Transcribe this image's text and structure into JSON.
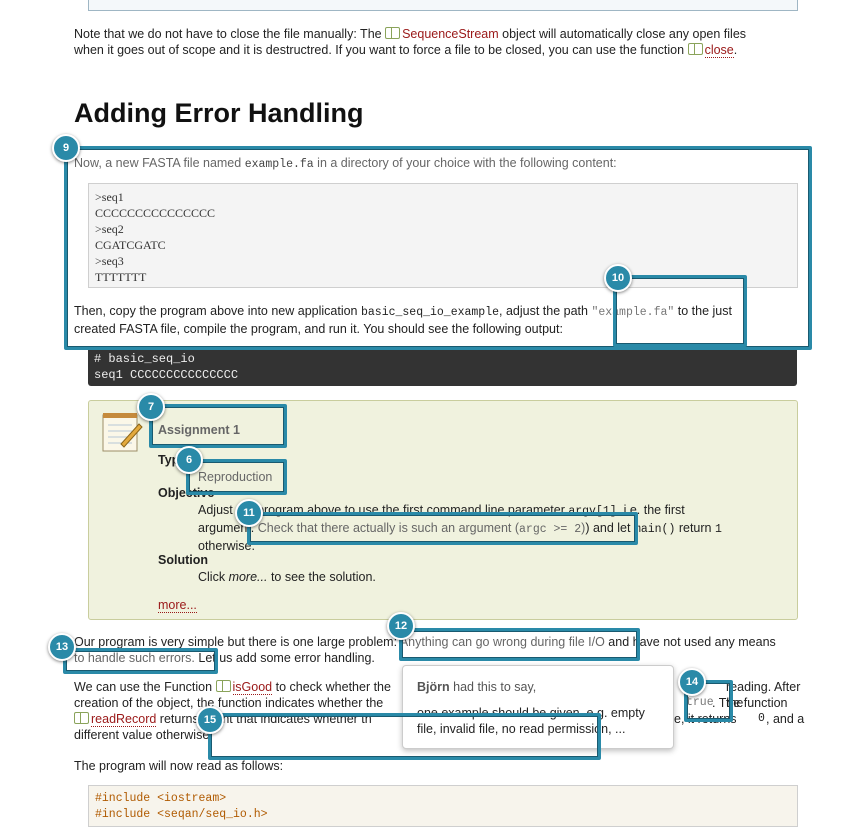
{
  "intro": {
    "p1_a": "Note that we do not have to close the file manually: The ",
    "p1_link": "SequenceStream",
    "p1_b": " object will automatically close any open files",
    "p2_a": "when it goes out of scope and it is destructred. If you want to force a file to be closed, you can use the function ",
    "p2_link": "close",
    "p2_b": "."
  },
  "section_title": "Adding Error Handling",
  "para_fasta": {
    "a": "Now, a new FASTA file named ",
    "code": "example.fa",
    "b": " in a directory of your choice with the following content:"
  },
  "fasta_lines": [
    ">seq1",
    "CCCCCCCCCCCCCCC",
    ">seq2",
    "CGATCGATC",
    ">seq3",
    "TTTTTTT"
  ],
  "para_copy": {
    "a": "Then, copy the program above into new application ",
    "code1": "basic_seq_io_example",
    "b": ", adjust the path ",
    "code2": "\"example.fa\"",
    "c": " to the just",
    "d": "created FASTA file, compile the program, and run it. You should see the following output:"
  },
  "output_lines": [
    "# basic_seq_io",
    "seq1    CCCCCCCCCCCCCCC"
  ],
  "assignment": {
    "title": "Assignment 1",
    "type_label": "Type",
    "type_value": "Reproduction",
    "objective_label": "Objective",
    "objective_1a": "Adjust the program above to use the first command line parameter ",
    "objective_1code": "argv[1]",
    "objective_1b": ", i.e. the first",
    "objective_2a": "argument. ",
    "objective_2b": "Check that there actually is such an argument (",
    "objective_2code": "argc >= 2",
    "objective_2c": ") and let ",
    "objective_2code2": "main()",
    "objective_2d": " return ",
    "objective_2code3": "1",
    "objective_3": "otherwise.",
    "solution_label": "Solution",
    "solution_a": "Click ",
    "solution_em": "more...",
    "solution_b": " to see the solution.",
    "more": "more..."
  },
  "para_simple": {
    "a": "Our program is very simple but there is one large problem: ",
    "b": "Anything can go wrong during file I/O",
    "c": " and have not used any means",
    "d": "to handle such errors.",
    "e": " Let us add some error handling."
  },
  "para_isgood": {
    "a": "We can use the Function ",
    "link1": "isGood",
    "b": " to check whether the",
    "c": "reading. After the",
    "d": "creation of the object, the function indicates whether the",
    "e": "true",
    "f": ". The function",
    "link2": "readRecord",
    "g": " returns an int that indicates whether th",
    "h": "e, it returns ",
    "code0": "0",
    "i": ", and a",
    "j": "different value otherwise."
  },
  "para_program": "The program will now read as follows:",
  "bottom_code": [
    "#include <iostream>",
    "#include <seqan/seq_io.h>"
  ],
  "comment": {
    "author": "Björn",
    "suffix": " had this to say,",
    "body": "one example should be given. e.g. empty file, invalid file, no read permission, ..."
  },
  "badges": [
    "9",
    "10",
    "7",
    "6",
    "11",
    "12",
    "13",
    "14",
    "15"
  ],
  "colors": {
    "highlight": "#2a8aa8",
    "link": "#9a1818",
    "assignment_bg": "#f0f2de"
  }
}
